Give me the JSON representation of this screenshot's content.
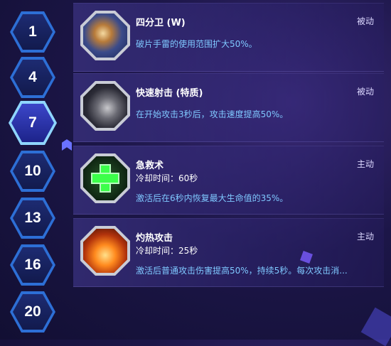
{
  "levels": [
    "1",
    "4",
    "7",
    "10",
    "13",
    "16",
    "20"
  ],
  "active_level": "7",
  "talents": [
    {
      "name": "四分卫 (W)",
      "type": "被动",
      "cooldown": "",
      "description": "破片手雷的使用范围扩大50%。",
      "icon": "grenade-icon"
    },
    {
      "name": "快速射击 (特质)",
      "type": "被动",
      "cooldown": "",
      "description": "在开始攻击3秒后，攻击速度提高50%。",
      "icon": "gun-icon"
    },
    {
      "name": "急救术",
      "type": "主动",
      "cooldown": "冷却时间：60秒",
      "description": "激活后在6秒内恢复最大生命值的35%。",
      "icon": "medical-cross-icon"
    },
    {
      "name": "灼热攻击",
      "type": "主动",
      "cooldown": "冷却时间：25秒",
      "description": "激活后普通攻击伤害提高50%，持续5秒。每次攻击消...",
      "icon": "fire-icon"
    }
  ],
  "colors": {
    "accent_blue": "#2d6fd6",
    "description_text": "#7fc8ff",
    "heal_green": "#3cff4a"
  }
}
